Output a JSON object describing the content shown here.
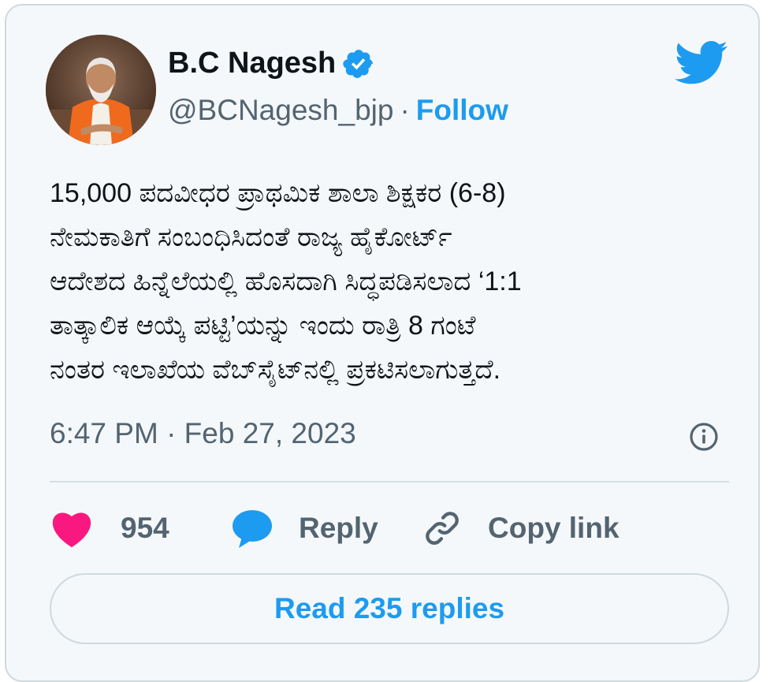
{
  "author": {
    "display_name": "B.C Nagesh",
    "handle": "@BCNagesh_bjp",
    "separator": "·",
    "follow_label": "Follow"
  },
  "tweet": {
    "lines": [
      "15,000 ಪದವೀಧರ ಪ್ರಾಥಮಿಕ ಶಾಲಾ ಶಿಕ್ಷಕರ (6-8)",
      "ನೇಮಕಾತಿಗೆ ಸಂಬಂಧಿಸಿದಂತೆ ರಾಜ್ಯ ಹೈಕೋರ್ಟ್",
      "ಆದೇಶದ ಹಿನ್ನೆಲೆಯಲ್ಲಿ ಹೊಸದಾಗಿ ಸಿದ್ಧಪಡಿಸಲಾದ ‘1:1",
      "ತಾತ್ಕಾಲಿಕ ಆಯ್ಕೆ ಪಟ್ಟಿ’ಯನ್ನು ಇಂದು ರಾತ್ರಿ 8 ಗಂಟೆ",
      "ನಂತರ ಇಲಾಖೆಯ ವೆಬ್‌ಸೈಟ್‌ನಲ್ಲಿ ಪ್ರಕಟಿಸಲಾಗುತ್ತದೆ."
    ],
    "timestamp": "6:47 PM · Feb 27, 2023"
  },
  "actions": {
    "like_count": "954",
    "reply_label": "Reply",
    "copy_link_label": "Copy link"
  },
  "read_replies_label": "Read 235 replies",
  "icons": {
    "verified": "verified-badge-icon",
    "twitter": "twitter-bird-icon",
    "info": "info-icon",
    "like": "heart-icon",
    "reply": "speech-bubble-icon",
    "copy_link": "link-icon"
  },
  "colors": {
    "accent": "#1d9bf0",
    "like": "#f91880",
    "text": "#0f1419",
    "muted": "#536471",
    "background": "#f5f8fa"
  }
}
